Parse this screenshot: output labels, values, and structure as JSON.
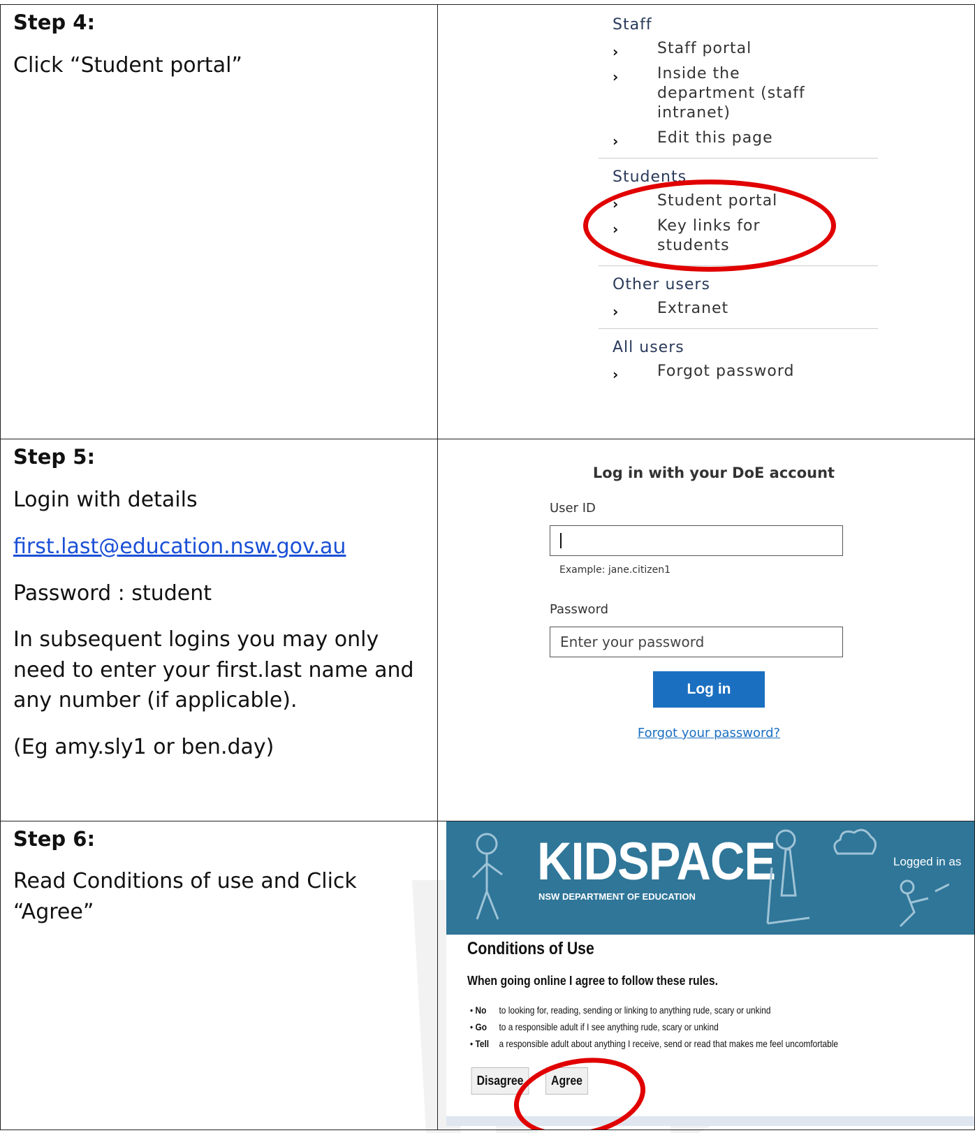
{
  "steps": [
    {
      "title": "Step 4:",
      "lines": [
        "Click “Student portal”"
      ]
    },
    {
      "title": "Step 5:",
      "lines": [
        "Login with details",
        "first.last@education.nsw.gov.au",
        "Password : student",
        "In subsequent logins you may only need to enter your first.last name and any number (if applicable).",
        "(Eg amy.sly1 or ben.day)"
      ]
    },
    {
      "title": "Step 6:",
      "lines": [
        "Read Conditions of use and Click “Agree”"
      ]
    }
  ],
  "menu": {
    "staff_heading": "Staff",
    "staff_items": [
      "Staff portal",
      "Inside the department (staff intranet)",
      "Edit this page"
    ],
    "students_heading": "Students",
    "students_items": [
      "Student portal",
      "Key links for students"
    ],
    "other_heading": "Other users",
    "other_items": [
      "Extranet"
    ],
    "all_heading": "All users",
    "all_items": [
      "Forgot password"
    ]
  },
  "login": {
    "title": "Log in with your DoE account",
    "user_label": "User ID",
    "user_hint": "Example: jane.citizen1",
    "password_label": "Password",
    "password_placeholder": "Enter your password",
    "button": "Log in",
    "forgot": "Forgot your password?"
  },
  "kidspace": {
    "logo": "KIDSPACE",
    "subtitle": "NSW DEPARTMENT OF EDUCATION",
    "logged_in": "Logged in as",
    "heading": "Conditions of Use",
    "subheading": "When going online I agree to follow these rules.",
    "rules": [
      {
        "key": "No",
        "text": "to looking for, reading, sending or linking to anything rude, scary or unkind"
      },
      {
        "key": "Go",
        "text": "to a responsible adult if I see anything rude, scary or unkind"
      },
      {
        "key": "Tell",
        "text": "a responsible adult about anything I receive, send or read that makes me feel uncomfortable"
      }
    ],
    "disagree": "Disagree",
    "agree": "Agree"
  },
  "colors": {
    "highlight": "#e10000",
    "link": "#1a4fd6",
    "login_button": "#1b6fc0",
    "kidspace_banner": "#2f7699"
  }
}
